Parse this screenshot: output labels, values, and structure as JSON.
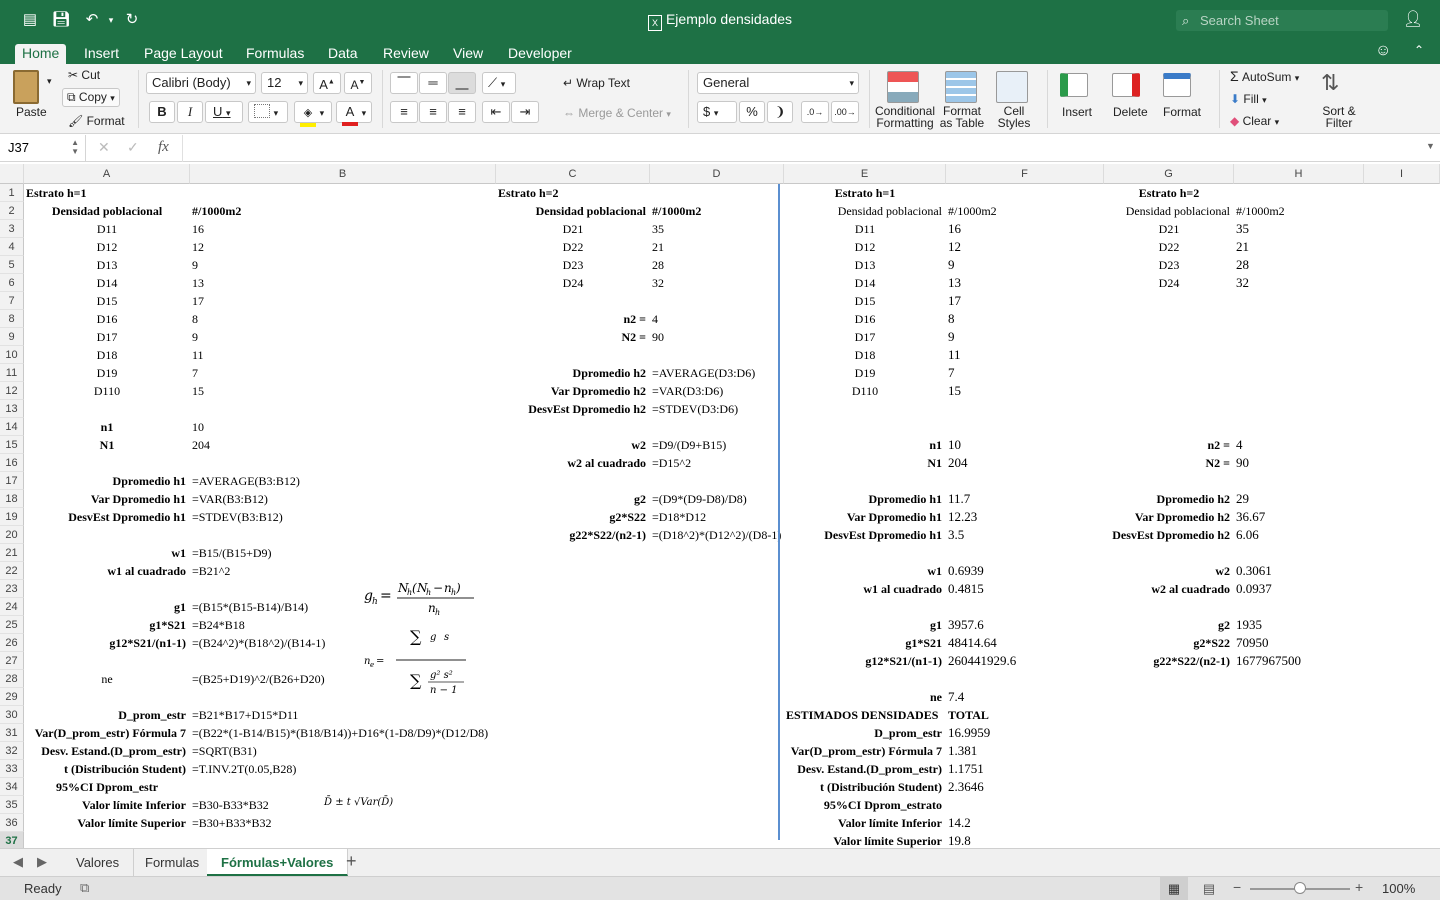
{
  "titlebar": {
    "title": "Ejemplo densidades",
    "search_placeholder": "Search Sheet"
  },
  "ribbon_tabs": [
    "Home",
    "Insert",
    "Page Layout",
    "Formulas",
    "Data",
    "Review",
    "View",
    "Developer"
  ],
  "ribbon": {
    "paste": "Paste",
    "cut": "Cut",
    "copy": "Copy",
    "format_painter": "Format",
    "font_name": "Calibri (Body)",
    "font_size": "12",
    "wrap_text": "Wrap Text",
    "merge_center": "Merge & Center",
    "number_format": "General",
    "conditional_formatting": [
      "Conditional",
      "Formatting"
    ],
    "format_as_table": [
      "Format",
      "as Table"
    ],
    "cell_styles": [
      "Cell",
      "Styles"
    ],
    "insert": "Insert",
    "delete": "Delete",
    "format": "Format",
    "autosum": "AutoSum",
    "fill": "Fill",
    "clear": "Clear",
    "sort_filter": [
      "Sort &",
      "Filter"
    ]
  },
  "formula_bar": {
    "name_box": "J37",
    "fx": "fx",
    "value": ""
  },
  "columns": [
    "A",
    "B",
    "C",
    "D",
    "E",
    "F",
    "G",
    "H",
    "I"
  ],
  "rows": [
    "1",
    "2",
    "3",
    "4",
    "5",
    "6",
    "7",
    "8",
    "9",
    "10",
    "11",
    "12",
    "13",
    "14",
    "15",
    "16",
    "17",
    "18",
    "19",
    "20",
    "21",
    "22",
    "23",
    "24",
    "25",
    "26",
    "27",
    "28",
    "29",
    "30",
    "31",
    "32",
    "33",
    "34",
    "35",
    "36",
    "37"
  ],
  "cells": {
    "A1": "Estrato h=1",
    "A2": "Densidad poblacional",
    "B2": "#/1000m2",
    "A3": "D11",
    "B3": "16",
    "A4": "D12",
    "B4": "12",
    "A5": "D13",
    "B5": "9",
    "A6": "D14",
    "B6": "13",
    "A7": "D15",
    "B7": "17",
    "A8": "D16",
    "B8": "8",
    "A9": "D17",
    "B9": "9",
    "A10": "D18",
    "B10": "11",
    "A11": "D19",
    "B11": "7",
    "A12": "D110",
    "B12": "15",
    "A14": "n1",
    "B14": "10",
    "A15": "N1",
    "B15": "204",
    "A17": "Dpromedio h1",
    "B17": "=AVERAGE(B3:B12)",
    "A18": "Var Dpromedio h1",
    "B18": "=VAR(B3:B12)",
    "A19": "DesvEst Dpromedio h1",
    "B19": "=STDEV(B3:B12)",
    "A21": "w1",
    "B21": "=B15/(B15+D9)",
    "A22": "w1 al cuadrado",
    "B22": "=B21^2",
    "A24": "g1",
    "B24": "=(B15*(B15-B14)/B14)",
    "A25": "g1*S21",
    "B25": "=B24*B18",
    "A26": "g12*S21/(n1-1)",
    "B26": "=(B24^2)*(B18^2)/(B14-1)",
    "A28": "ne",
    "B28": "=(B25+D19)^2/(B26+D20)",
    "A30": "D_prom_estr",
    "B30": "=B21*B17+D15*D11",
    "A31": "Var(D_prom_estr) Fórmula 7",
    "B31": "=(B22*(1-B14/B15)*(B18/B14))+D16*(1-D8/D9)*(D12/D8)",
    "A32": "Desv. Estand.(D_prom_estr)",
    "B32": "=SQRT(B31)",
    "A33": "t (Distribución Student)",
    "B33": "=T.INV.2T(0.05,B28)",
    "A34": "95%CI Dprom_estr",
    "A35": "Valor límite Inferior",
    "B35": "=B30-B33*B32",
    "A36": "Valor límite Superior",
    "B36": "=B30+B33*B32",
    "C1": "Estrato h=2",
    "C2": "Densidad poblacional",
    "D2": "#/1000m2",
    "C3": "D21",
    "D3": "35",
    "C4": "D22",
    "D4": "21",
    "C5": "D23",
    "D5": "28",
    "C6": "D24",
    "D6": "32",
    "C8": "n2 =",
    "D8": "4",
    "C9": "N2 =",
    "D9": "90",
    "C11": "Dpromedio h2",
    "D11": "=AVERAGE(D3:D6)",
    "C12": "Var Dpromedio h2",
    "D12": "=VAR(D3:D6)",
    "C13": "DesvEst Dpromedio h2",
    "D13": "=STDEV(D3:D6)",
    "C15": "w2",
    "D15": "=D9/(D9+B15)",
    "C16": "w2 al cuadrado",
    "D16": "=D15^2",
    "C18": "g2",
    "D18": "=(D9*(D9-D8)/D8)",
    "C19": "g2*S22",
    "D19": "=D18*D12",
    "C20": "g22*S22/(n2-1)",
    "D20": "=(D18^2)*(D12^2)/(D8-1)",
    "E1": "Estrato h=1",
    "E2": "Densidad poblacional",
    "F2": "#/1000m2",
    "E3": "D11",
    "F3": "16",
    "E4": "D12",
    "F4": "12",
    "E5": "D13",
    "F5": "9",
    "E6": "D14",
    "F6": "13",
    "E7": "D15",
    "F7": "17",
    "E8": "D16",
    "F8": "8",
    "E9": "D17",
    "F9": "9",
    "E10": "D18",
    "F10": "11",
    "E11": "D19",
    "F11": "7",
    "E12": "D110",
    "F12": "15",
    "E15": "n1",
    "F15": "10",
    "E16": "N1",
    "F16": "204",
    "E18": "Dpromedio h1",
    "F18": "11.7",
    "E19": "Var Dpromedio h1",
    "F19": "12.23",
    "E20": "DesvEst Dpromedio h1",
    "F20": "3.5",
    "E22": "w1",
    "F22": "0.6939",
    "E23": "w1 al cuadrado",
    "F23": "0.4815",
    "E25": "g1",
    "F25": "3957.6",
    "E26": "g1*S21",
    "F26": "48414.64",
    "E27": "g12*S21/(n1-1)",
    "F27": "260441929.6",
    "E29": "ne",
    "F29": "7.4",
    "E30": "ESTIMADOS DENSIDADES",
    "F30": "TOTAL",
    "E31": "D_prom_estr",
    "F31": "16.9959",
    "E32": "Var(D_prom_estr) Fórmula 7",
    "F32": "1.381",
    "E33": "Desv. Estand.(D_prom_estr)",
    "F33": "1.1751",
    "E34": "t (Distribución Student)",
    "F34": "2.3646",
    "E35": "95%CI Dprom_estrato",
    "E36": "Valor límite Inferior",
    "F36": "14.2",
    "E37": "Valor límite Superior",
    "F37": "19.8",
    "G1": "Estrato h=2",
    "G2": "Densidad poblacional",
    "H2": "#/1000m2",
    "G3": "D21",
    "H3": "35",
    "G4": "D22",
    "H4": "21",
    "G5": "D23",
    "H5": "28",
    "G6": "D24",
    "H6": "32",
    "G15": "n2 =",
    "H15": "4",
    "G16": "N2 =",
    "H16": "90",
    "G18": "Dpromedio h2",
    "H18": "29",
    "G19": "Var Dpromedio h2",
    "H19": "36.67",
    "G20": "DesvEst Dpromedio h2",
    "H20": "6.06",
    "G22": "w2",
    "H22": "0.3061",
    "G23": "w2 al cuadrado",
    "H23": "0.0937",
    "G25": "g2",
    "H25": "1935",
    "G26": "g2*S22",
    "H26": "70950",
    "G27": "g22*S22/(n2-1)",
    "H27": "1677967500"
  },
  "sheets": [
    "Valores",
    "Formulas",
    "Fórmulas+Valores"
  ],
  "active_sheet": "Fórmulas+Valores",
  "status": {
    "state": "Ready",
    "zoom": "100%"
  },
  "colors": {
    "brand": "#1e7145",
    "divider": "#5b8fd0"
  }
}
